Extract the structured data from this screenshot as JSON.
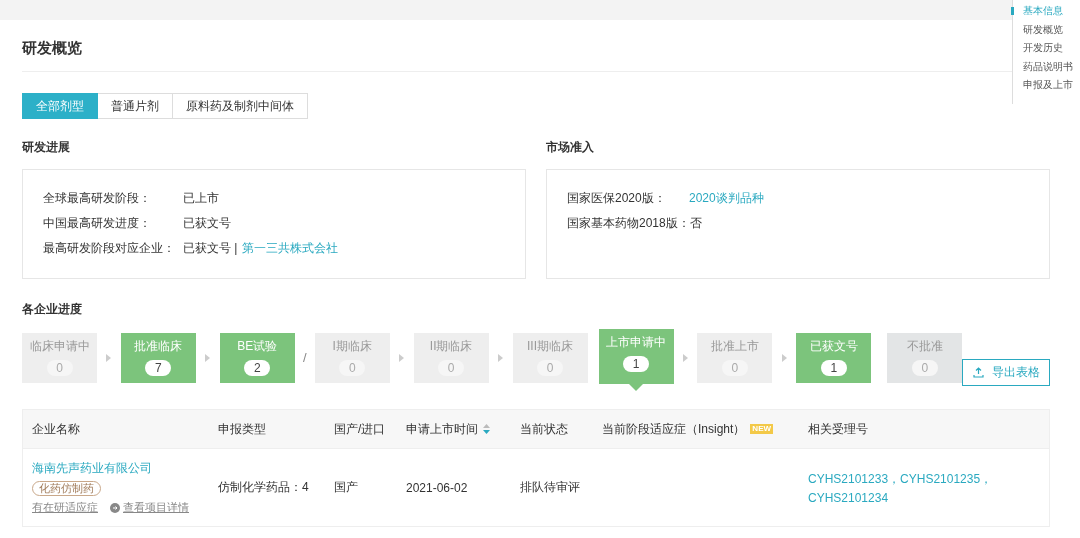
{
  "page_title": "研发概览",
  "tabs": [
    {
      "label": "全部剂型",
      "selected": true
    },
    {
      "label": "普通片剂",
      "selected": false
    },
    {
      "label": "原料药及制剂中间体",
      "selected": false
    }
  ],
  "progress": {
    "title": "研发进展",
    "rows": [
      {
        "label": "全球最高研发阶段：",
        "value": "已上市"
      },
      {
        "label": "中国最高研发进度：",
        "value": "已获文号"
      },
      {
        "label": "最高研发阶段对应企业：",
        "value": "已获文号 |",
        "link": "第一三共株式会社"
      }
    ]
  },
  "market": {
    "title": "市场准入",
    "rows": [
      {
        "label": "国家医保2020版：",
        "link": "2020谈判品种"
      },
      {
        "label": "国家基本药物2018版：",
        "value": "否"
      }
    ]
  },
  "pipeline": {
    "title": "各企业进度",
    "items": [
      {
        "kind": "stage",
        "label": "临床申请中",
        "count": "0",
        "highlighted": false,
        "selected": false
      },
      {
        "kind": "arrow"
      },
      {
        "kind": "stage",
        "label": "批准临床",
        "count": "7",
        "highlighted": true,
        "selected": false
      },
      {
        "kind": "arrow"
      },
      {
        "kind": "stage",
        "label": "BE试验",
        "count": "2",
        "highlighted": true,
        "selected": false
      },
      {
        "kind": "slash",
        "text": "/"
      },
      {
        "kind": "stage",
        "label": "I期临床",
        "count": "0",
        "highlighted": false,
        "selected": false
      },
      {
        "kind": "arrow"
      },
      {
        "kind": "stage",
        "label": "II期临床",
        "count": "0",
        "highlighted": false,
        "selected": false
      },
      {
        "kind": "arrow"
      },
      {
        "kind": "stage",
        "label": "III期临床",
        "count": "0",
        "highlighted": false,
        "selected": false
      },
      {
        "kind": "stage",
        "label": "上市申请中",
        "count": "1",
        "highlighted": true,
        "selected": true
      },
      {
        "kind": "arrow"
      },
      {
        "kind": "stage",
        "label": "批准上市",
        "count": "0",
        "highlighted": false,
        "selected": false
      },
      {
        "kind": "arrow"
      },
      {
        "kind": "stage",
        "label": "已获文号",
        "count": "1",
        "highlighted": true,
        "selected": false
      },
      {
        "kind": "rejected",
        "label": "不批准",
        "count": "0",
        "highlighted": false,
        "selected": false
      }
    ],
    "export_button": "导出表格"
  },
  "table": {
    "columns": [
      {
        "label": "企业名称"
      },
      {
        "label": "申报类型"
      },
      {
        "label": "国产/进口"
      },
      {
        "label": "申请上市时间",
        "sortable": true
      },
      {
        "label": "当前状态"
      },
      {
        "label": "当前阶段适应症（Insight）",
        "badge": "NEW"
      },
      {
        "label": "相关受理号"
      }
    ],
    "rows": [
      {
        "company": "海南先声药业有限公司",
        "tag": "化药仿制药",
        "indication_link": "有在研适应症",
        "detail_link": "查看项目详情",
        "type": "仿制化学药品：4",
        "origin": "国产",
        "date": "2021-06-02",
        "status": "排队待审评",
        "indication": null,
        "numbers": [
          "CYHS2101233，",
          "CYHS2101235，",
          "CYHS2101234"
        ]
      }
    ]
  },
  "side_nav": [
    {
      "label": "基本信息",
      "selected": true
    },
    {
      "label": "研发概览",
      "selected": false
    },
    {
      "label": "开发历史",
      "selected": false
    },
    {
      "label": "药品说明书",
      "selected": false
    },
    {
      "label": "申报及上市",
      "selected": false
    }
  ]
}
